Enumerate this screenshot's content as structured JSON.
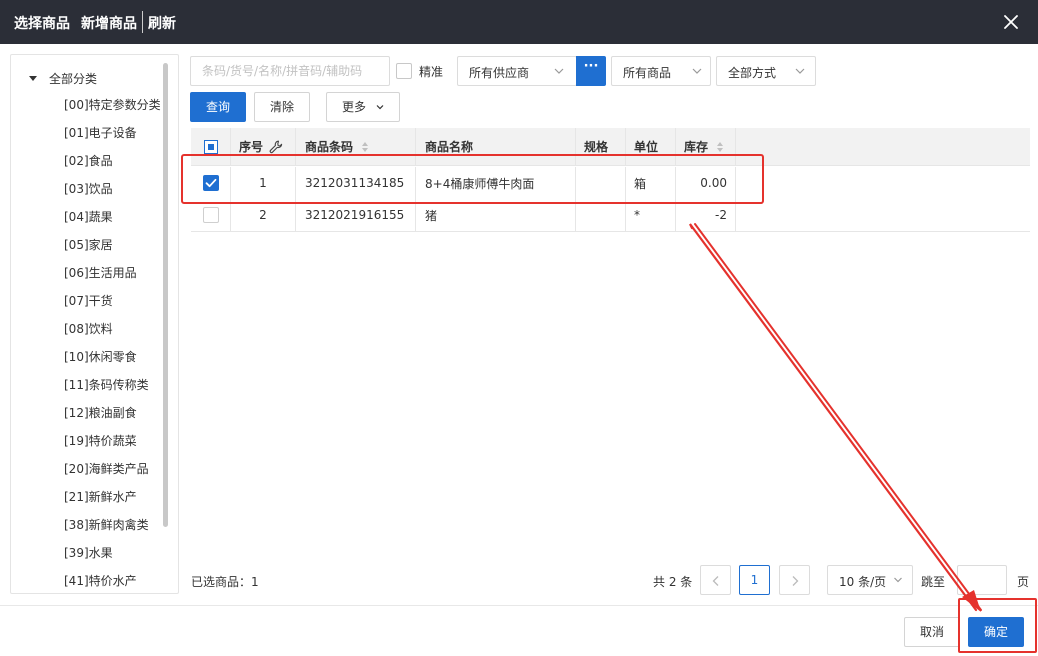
{
  "dialog": {
    "title": "选择商品",
    "add_product": "新增商品",
    "refresh": "刷新"
  },
  "tree": {
    "root": "全部分类",
    "items": [
      "[00]特定参数分类",
      "[01]电子设备",
      "[02]食品",
      "[03]饮品",
      "[04]蔬果",
      "[05]家居",
      "[06]生活用品",
      "[07]干货",
      "[08]饮料",
      "[10]休闲零食",
      "[11]条码传称类",
      "[12]粮油副食",
      "[19]特价蔬菜",
      "[20]海鲜类产品",
      "[21]新鲜水产",
      "[38]新鲜肉禽类",
      "[39]水果",
      "[41]特价水产"
    ]
  },
  "filters": {
    "search_placeholder": "条码/货号/名称/拼音码/辅助码",
    "exact_label": "精准",
    "supplier": "所有供应商",
    "supplier_more": "···",
    "goods": "所有商品",
    "method": "全部方式"
  },
  "actions": {
    "query": "查询",
    "clear": "清除",
    "more": "更多"
  },
  "table": {
    "columns": {
      "seq": "序号",
      "code": "商品条码",
      "name": "商品名称",
      "spec": "规格",
      "unit": "单位",
      "stock": "库存"
    },
    "rows": [
      {
        "selected": true,
        "seq": "1",
        "code": "3212031134185",
        "name": "8+4桶康师傅牛肉面",
        "spec": "",
        "unit": "箱",
        "stock": "0.00"
      },
      {
        "selected": false,
        "seq": "2",
        "code": "3212021916155",
        "name": "猪",
        "spec": "",
        "unit": "*",
        "stock": "-2"
      }
    ]
  },
  "pagination": {
    "selected_label": "已选商品：1",
    "total": "共 2 条",
    "current_page": "1",
    "page_size": "10 条/页",
    "jump_label": "跳至",
    "jump_value": "",
    "page_unit": "页"
  },
  "footer": {
    "cancel": "取消",
    "ok": "确定"
  },
  "colors": {
    "primary": "#1f6fd1",
    "titlebar": "#2b2e37",
    "annotation": "#e5322d"
  }
}
